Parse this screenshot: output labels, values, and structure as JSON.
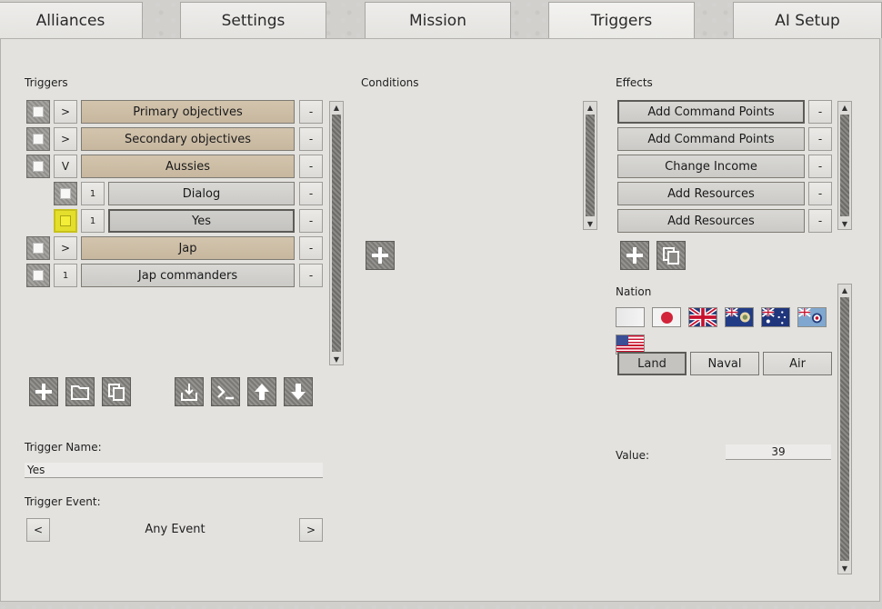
{
  "tabs": [
    {
      "label": "Alliances",
      "active": false
    },
    {
      "label": "Settings",
      "active": false
    },
    {
      "label": "Mission",
      "active": false
    },
    {
      "label": "Triggers",
      "active": true
    },
    {
      "label": "AI Setup",
      "active": false
    }
  ],
  "triggers": {
    "heading": "Triggers",
    "remove_label": "-",
    "items": [
      {
        "label": "Primary objectives",
        "toggle": ">",
        "kind": "group",
        "indent": 0,
        "selected": false
      },
      {
        "label": "Secondary objectives",
        "toggle": ">",
        "kind": "group",
        "indent": 0,
        "selected": false
      },
      {
        "label": "Aussies",
        "toggle": "V",
        "kind": "group",
        "indent": 0,
        "selected": false
      },
      {
        "label": "Dialog",
        "toggle": "1",
        "kind": "item",
        "indent": 1,
        "selected": false
      },
      {
        "label": "Yes",
        "toggle": "1",
        "kind": "item",
        "indent": 1,
        "selected": true
      },
      {
        "label": "Jap",
        "toggle": ">",
        "kind": "group",
        "indent": 0,
        "selected": false
      },
      {
        "label": "Jap commanders",
        "toggle": "1",
        "kind": "item",
        "indent": 0,
        "selected": false
      }
    ],
    "name_label": "Trigger Name:",
    "name_value": "Yes",
    "event_label": "Trigger Event:",
    "event_value": "Any Event",
    "event_prev": "<",
    "event_next": ">"
  },
  "conditions": {
    "heading": "Conditions"
  },
  "effects": {
    "heading": "Effects",
    "remove_label": "-",
    "items": [
      {
        "label": "Add Command Points",
        "selected": true
      },
      {
        "label": "Add Command Points",
        "selected": false
      },
      {
        "label": "Change Income",
        "selected": false
      },
      {
        "label": "Add Resources",
        "selected": false
      },
      {
        "label": "Add Resources",
        "selected": false
      }
    ],
    "nation_label": "Nation",
    "flags": [
      "blank-flag-icon",
      "japan-flag-icon",
      "uk-flag-icon",
      "new-zealand-blue-ensign-icon",
      "australia-flag-icon",
      "raaf-roundel-flag-icon",
      "usa-flag-icon"
    ],
    "unit_types": [
      {
        "label": "Land",
        "selected": true
      },
      {
        "label": "Naval",
        "selected": false
      },
      {
        "label": "Air",
        "selected": false
      }
    ],
    "value_label": "Value:",
    "value": "39"
  },
  "colors": {
    "group_bar": "#cbbca5",
    "item_bar": "#d2d1ce",
    "selected_highlight": "#e4de2c"
  }
}
